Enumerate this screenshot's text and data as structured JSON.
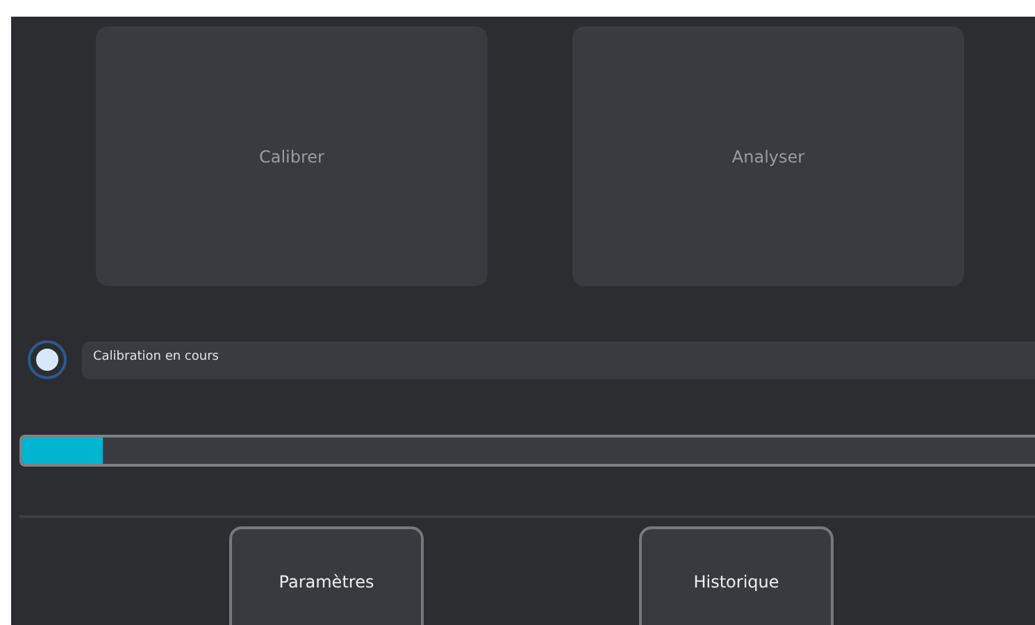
{
  "tiles": [
    {
      "label": "Calibrer"
    },
    {
      "label": "Analyser"
    }
  ],
  "status": {
    "checked": true,
    "text": "Calibration en cours"
  },
  "progress": {
    "level": 0.08
  },
  "buttons": [
    {
      "label": "Paramètres"
    },
    {
      "label": "Historique"
    }
  ]
}
